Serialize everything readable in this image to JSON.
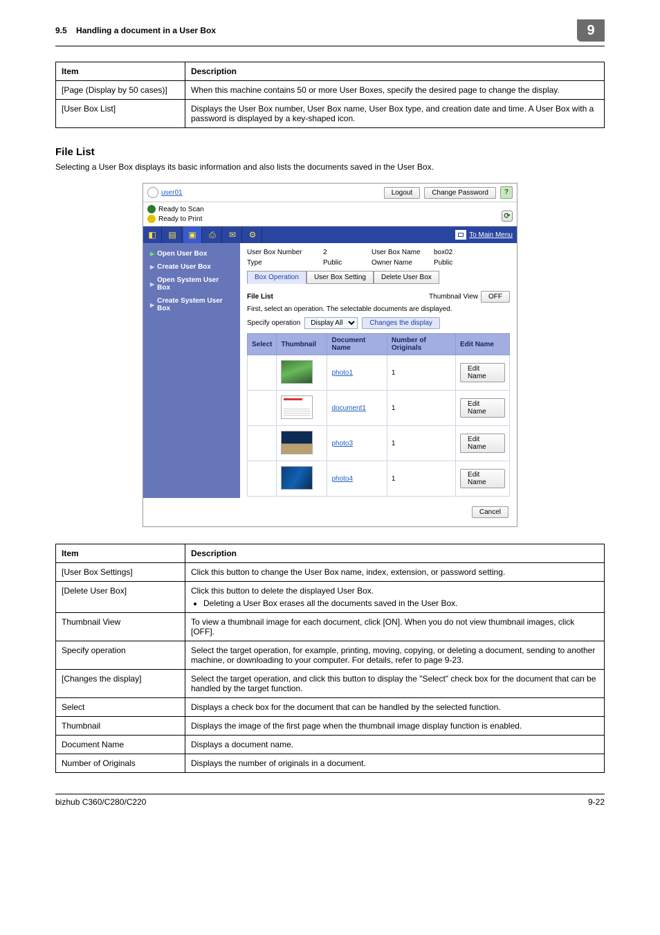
{
  "header": {
    "section_no": "9.5",
    "section_title": "Handling a document in a User Box",
    "chapter": "9"
  },
  "table1": {
    "headers": {
      "item": "Item",
      "desc": "Description"
    },
    "rows": [
      {
        "item": "[Page (Display by 50 cases)]",
        "desc": "When this machine contains 50 or more User Boxes, specify the desired page to change the display."
      },
      {
        "item": "[User Box List]",
        "desc": "Displays the User Box number, User Box name, User Box type, and creation date and time. A User Box with a password is displayed by a key-shaped icon."
      }
    ]
  },
  "file_list_section": {
    "heading": "File List",
    "lead": "Selecting a User Box displays its basic information and also lists the documents saved in the User Box."
  },
  "screenshot": {
    "user": "user01",
    "logout": "Logout",
    "change_pw": "Change Password",
    "status1": "Ready to Scan",
    "status2": "Ready to Print",
    "main_menu": "To Main Menu",
    "sidebar": {
      "items": [
        {
          "label": "Open User Box"
        },
        {
          "label": "Create User Box"
        },
        {
          "label": "Open System User Box"
        },
        {
          "label": "Create System User Box"
        }
      ]
    },
    "info": {
      "box_no_lab": "User Box Number",
      "box_no_val": "2",
      "box_name_lab": "User Box Name",
      "box_name_val": "box02",
      "type_lab": "Type",
      "type_val": "Public",
      "owner_lab": "Owner Name",
      "owner_val": "Public"
    },
    "tabs": {
      "op": "Box Operation",
      "set": "User Box Setting",
      "del": "Delete User Box"
    },
    "fl_label": "File List",
    "thumb_view_lab": "Thumbnail View",
    "thumb_view_val": "OFF",
    "instr": "First, select an operation. The selectable documents are displayed.",
    "specify_lab": "Specify operation",
    "specify_val": "Display All",
    "changes_btn": "Changes the display",
    "doc_headers": {
      "sel": "Select",
      "thumb": "Thumbnail",
      "name": "Document Name",
      "num": "Number of Originals",
      "edit": "Edit Name"
    },
    "docs": [
      {
        "name": "photo1",
        "num": "1",
        "class": "photo1"
      },
      {
        "name": "document1",
        "num": "1",
        "class": "doc1"
      },
      {
        "name": "photo3",
        "num": "1",
        "class": "photo3"
      },
      {
        "name": "photo4",
        "num": "1",
        "class": "photo4"
      }
    ],
    "edit_name_btn": "Edit Name",
    "cancel": "Cancel"
  },
  "table2": {
    "headers": {
      "item": "Item",
      "desc": "Description"
    },
    "rows": [
      {
        "item": "[User Box Settings]",
        "desc": "Click this button to change the User Box name, index, extension, or password setting."
      },
      {
        "item": "[Delete User Box]",
        "desc_pre": "Click this button to delete the displayed User Box.",
        "bullet": "Deleting a User Box erases all the documents saved in the User Box."
      },
      {
        "item": "Thumbnail View",
        "desc": "To view a thumbnail image for each document, click [ON]. When you do not view thumbnail images, click [OFF]."
      },
      {
        "item": "Specify operation",
        "desc": "Select the target operation, for example, printing, moving, copying, or deleting a document, sending to another machine, or downloading to your computer. For details, refer to page 9-23."
      },
      {
        "item": "[Changes the display]",
        "desc": "Select the target operation, and click this button to display the \"Select\" check box for the document that can be handled by the target function."
      },
      {
        "item": "Select",
        "desc": "Displays a check box for the document that can be handled by the selected function."
      },
      {
        "item": "Thumbnail",
        "desc": "Displays the image of the first page when the thumbnail image display function is enabled."
      },
      {
        "item": "Document Name",
        "desc": "Displays a document name."
      },
      {
        "item": "Number of Originals",
        "desc": "Displays the number of originals in a document."
      }
    ]
  },
  "footer": {
    "model": "bizhub C360/C280/C220",
    "page": "9-22"
  }
}
